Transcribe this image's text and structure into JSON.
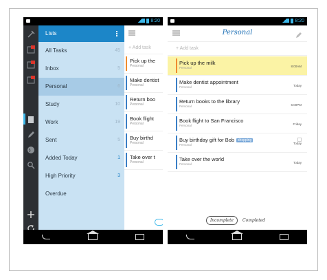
{
  "status": {
    "time": "8:20"
  },
  "rail_icons": [
    "tools-icon",
    "calendar-badge-icon",
    "inbox-badge-icon",
    "badge-icon",
    "list-icon",
    "pencil-icon",
    "globe-icon",
    "search-icon",
    "add-icon",
    "sync-icon"
  ],
  "lists_panel": {
    "title": "Lists",
    "items": [
      {
        "label": "All Tasks",
        "count": "45"
      },
      {
        "label": "Inbox",
        "count": "5"
      },
      {
        "label": "Personal",
        "count": "6"
      },
      {
        "label": "Study",
        "count": "10"
      },
      {
        "label": "Work",
        "count": "19"
      },
      {
        "label": "Sent",
        "count": "5"
      },
      {
        "label": "Added Today",
        "count": "1"
      },
      {
        "label": "High Priority",
        "count": "3"
      },
      {
        "label": "Overdue",
        "count": ""
      }
    ]
  },
  "peek": {
    "add_task": "+ Add task",
    "tasks": [
      {
        "title": "Pick up the",
        "sub": "Personal"
      },
      {
        "title": "Make dentist",
        "sub": "Personal"
      },
      {
        "title": "Return boo",
        "sub": "Personal"
      },
      {
        "title": "Book flight",
        "sub": "Personal"
      },
      {
        "title": "Buy birthd",
        "sub": "Personal"
      },
      {
        "title": "Take over t",
        "sub": "Personal"
      }
    ]
  },
  "detail": {
    "title": "Personal",
    "add_task": "+ Add task",
    "tasks": [
      {
        "title": "Pick up the milk",
        "sub": "Personal",
        "due": "8:00AM",
        "tag": ""
      },
      {
        "title": "Make dentist appointment",
        "sub": "Personal",
        "due": "Today",
        "tag": ""
      },
      {
        "title": "Return books to the library",
        "sub": "Personal",
        "due": "6:00PM",
        "tag": ""
      },
      {
        "title": "Book flight to San Francisco",
        "sub": "Personal",
        "due": "Friday",
        "tag": ""
      },
      {
        "title": "Buy birthday gift for Bob",
        "sub": "Personal",
        "due": "Today",
        "tag": "shopping"
      },
      {
        "title": "Take over the world",
        "sub": "Personal",
        "due": "Today",
        "tag": ""
      }
    ],
    "segment": {
      "incomplete": "Incomplete",
      "completed": "Completed"
    }
  },
  "colors": {
    "accent": "#1c86c8",
    "highlight": "#fbf3a5",
    "priority": "#f08c2f"
  }
}
